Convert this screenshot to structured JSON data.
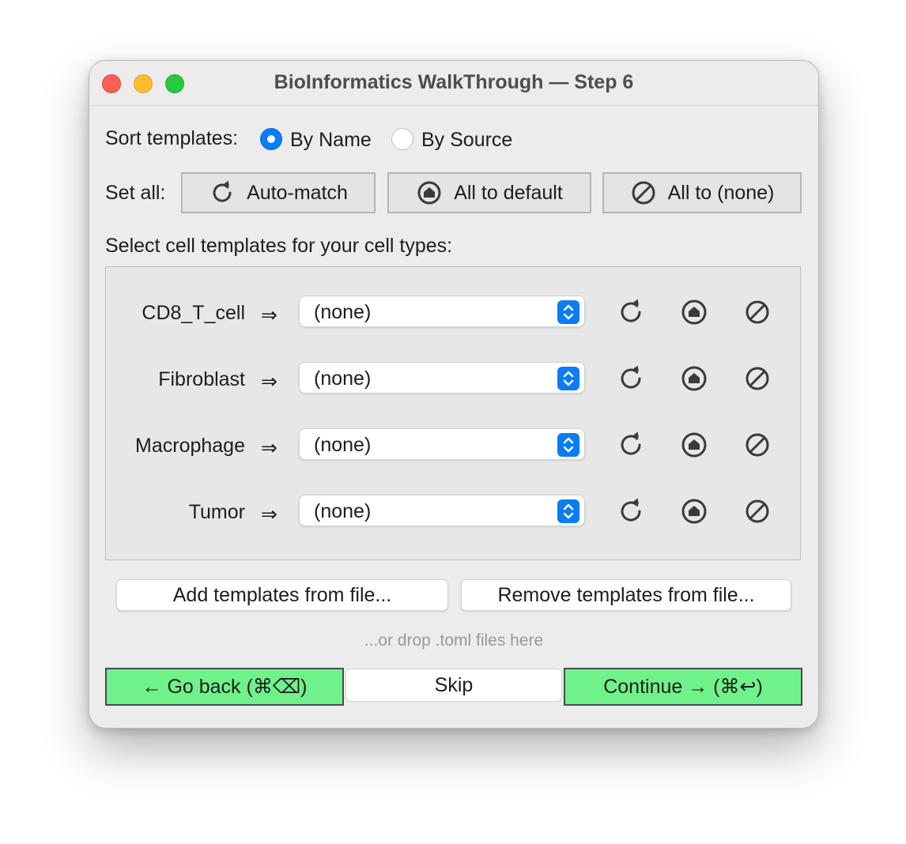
{
  "window": {
    "title": "BioInformatics WalkThrough — Step 6"
  },
  "sort": {
    "label": "Sort templates:",
    "options": [
      {
        "label": "By Name",
        "selected": true
      },
      {
        "label": "By Source",
        "selected": false
      }
    ]
  },
  "set_all": {
    "label": "Set all:",
    "buttons": [
      {
        "label": "Auto-match",
        "icon": "refresh-icon"
      },
      {
        "label": "All to default",
        "icon": "home-target-icon"
      },
      {
        "label": "All to (none)",
        "icon": "no-entry-icon"
      }
    ]
  },
  "section_label": "Select cell templates for your cell types:",
  "rows": [
    {
      "cell_type": "CD8_T_cell",
      "arrow": "⇒",
      "selected": "(none)"
    },
    {
      "cell_type": "Fibroblast",
      "arrow": "⇒",
      "selected": "(none)"
    },
    {
      "cell_type": "Macrophage",
      "arrow": "⇒",
      "selected": "(none)"
    },
    {
      "cell_type": "Tumor",
      "arrow": "⇒",
      "selected": "(none)"
    }
  ],
  "file_buttons": {
    "add": "Add templates from file...",
    "remove": "Remove templates from file..."
  },
  "drop_hint": "...or drop .toml files here",
  "nav": {
    "back": "← Go back (⌘⌫)",
    "skip": "Skip",
    "continue": "Continue → (⌘↩)"
  },
  "colors": {
    "accent": "#0a7cf5",
    "nav_green": "#6ff28a",
    "window_bg": "#ececec"
  }
}
